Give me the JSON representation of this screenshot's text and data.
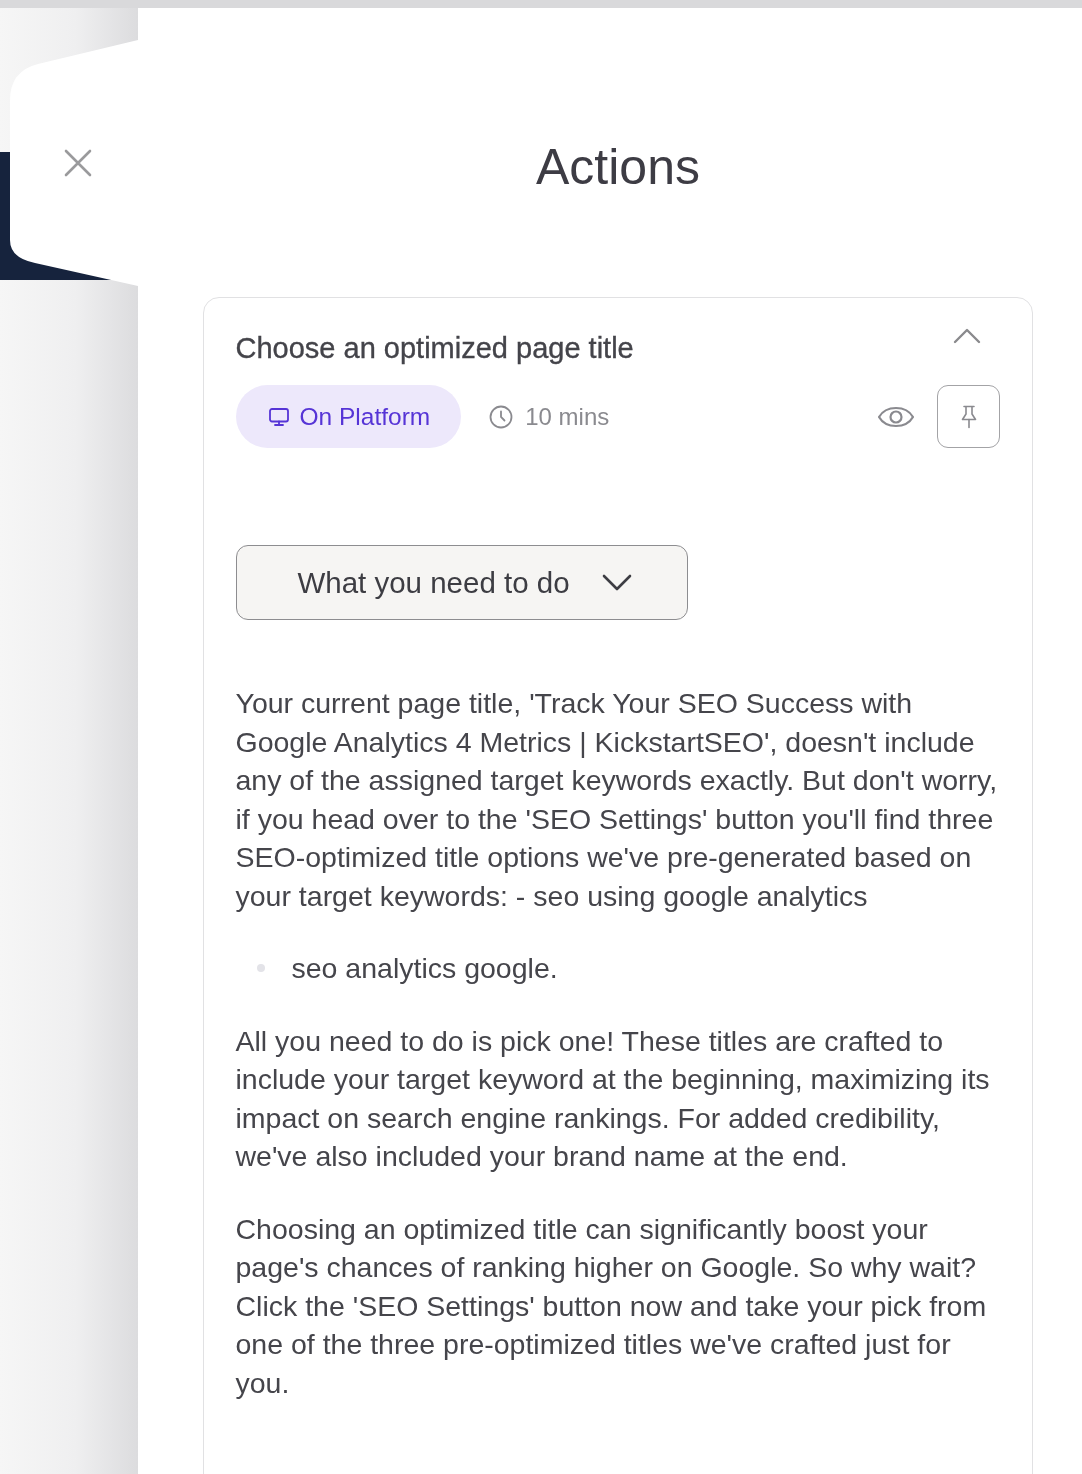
{
  "title": "Actions",
  "action_card": {
    "title": "Choose an optimized page title",
    "expanded": true,
    "channel": "On Platform",
    "duration": "10 mins",
    "section_toggle": "What you need to do",
    "content": [
      {
        "kind": "paragraph",
        "text": "Your current page title, 'Track Your SEO Success with Google Analytics 4 Metrics | KickstartSEO', doesn't include any of the assigned target keywords exactly. But don't worry, if you head over to the 'SEO Settings' button you'll find three SEO-optimized title options we've pre-generated based on your target keywords: - seo using google analytics"
      },
      {
        "kind": "bullet_list",
        "items": [
          "seo analytics google."
        ]
      },
      {
        "kind": "paragraph",
        "text": "All you need to do is pick one! These titles are crafted to include your target keyword at the beginning, maximizing its impact on search engine rankings. For added credibility, we've also included your brand name at the end."
      },
      {
        "kind": "paragraph",
        "text": "Choosing an optimized title can significantly boost your page's chances of ranking higher on Google. So why wait? Click the 'SEO Settings' button now and take your pick from one of the three pre-optimized titles we've crafted just for you."
      }
    ]
  }
}
